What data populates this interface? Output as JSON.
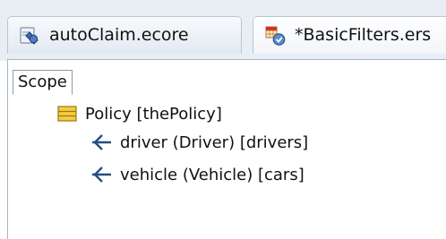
{
  "tabs": [
    {
      "label": "autoClaim.ecore",
      "icon": "ecore-model-icon",
      "active": false
    },
    {
      "label": "*BasicFilters.ers",
      "icon": "filters-editor-icon",
      "active": true,
      "dirty": true
    }
  ],
  "scope_tab": {
    "label": "Scope"
  },
  "tree": {
    "root": {
      "label": "Policy [thePolicy]",
      "icon": "class-icon"
    },
    "children": [
      {
        "label": "driver (Driver) [drivers]",
        "icon": "reference-icon"
      },
      {
        "label": "vehicle (Vehicle) [cars]",
        "icon": "reference-icon"
      }
    ]
  },
  "colors": {
    "tab_strip": "#e9eef5",
    "class_icon": "#f2cd41",
    "reference_icon": "#244f80"
  }
}
